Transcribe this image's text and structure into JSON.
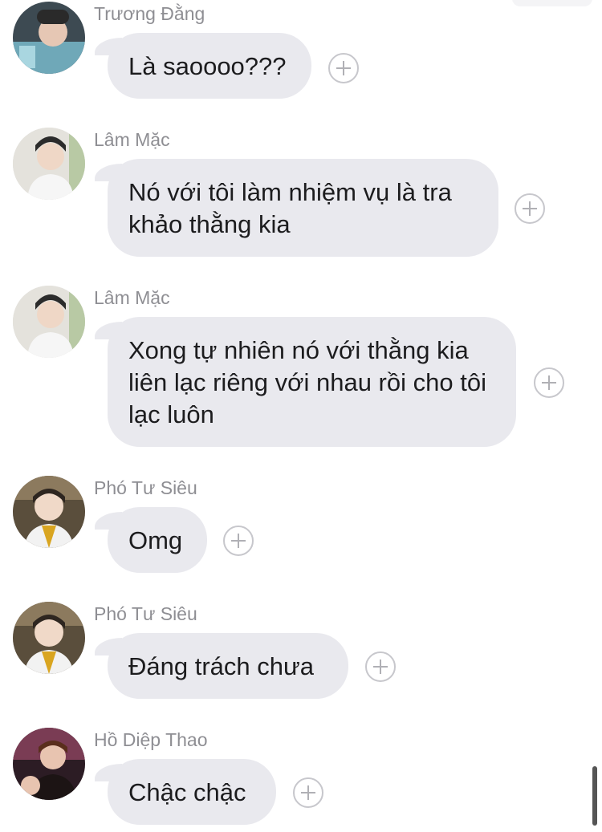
{
  "messages": [
    {
      "sender": "Trương Đằng",
      "text": "Là saoooo???",
      "avatar": "avatar-truong-dang"
    },
    {
      "sender": "Lâm Mặc",
      "text": "Nó với tôi làm nhiệm vụ là tra khảo thằng kia",
      "avatar": "avatar-lam-mac"
    },
    {
      "sender": "Lâm Mặc",
      "text": "Xong tự nhiên nó với thằng kia liên lạc riêng với nhau rồi cho tôi lạc luôn",
      "avatar": "avatar-lam-mac"
    },
    {
      "sender": "Phó Tư Siêu",
      "text": "Omg",
      "avatar": "avatar-pho-tu-sieu"
    },
    {
      "sender": "Phó Tư Siêu",
      "text": "Đáng trách chưa",
      "avatar": "avatar-pho-tu-sieu"
    },
    {
      "sender": "Hồ Diệp Thao",
      "text": "Chậc chậc",
      "avatar": "avatar-ho-diep-thao"
    }
  ],
  "icons": {
    "reaction": "add-reaction-icon"
  },
  "colors": {
    "bubble": "#e9e9ee",
    "sender_name": "#8e8e93",
    "text": "#1c1c1e",
    "reaction_border": "#c7c7cc"
  }
}
